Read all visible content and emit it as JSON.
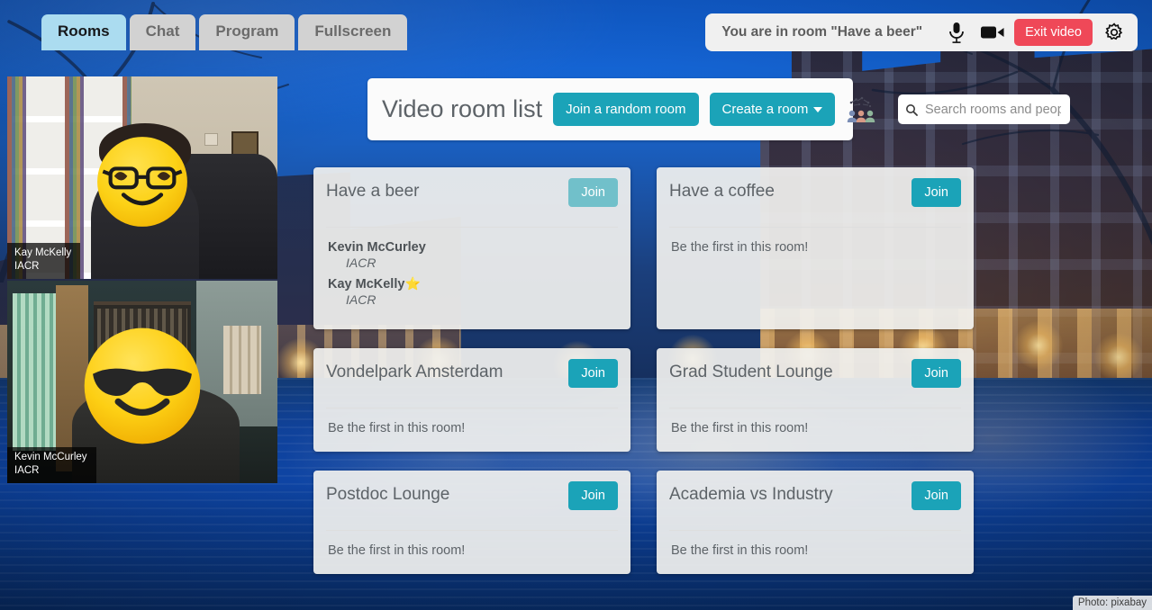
{
  "nav": {
    "tabs": [
      {
        "label": "Rooms",
        "active": true
      },
      {
        "label": "Chat",
        "active": false
      },
      {
        "label": "Program",
        "active": false
      },
      {
        "label": "Fullscreen",
        "active": false
      }
    ]
  },
  "topbar": {
    "room_status": "You are in room \"Have a beer\"",
    "mic_icon": "microphone-icon",
    "camera_icon": "video-camera-icon",
    "exit_label": "Exit video",
    "settings_icon": "gear-icon",
    "exit_color": "#ef4858"
  },
  "video_tiles": [
    {
      "name": "Kay McKelly",
      "affiliation": "IACR",
      "avatar_emoji": "nerd-face",
      "scene": "bookshelf-office"
    },
    {
      "name": "Kevin McCurley",
      "affiliation": "IACR",
      "avatar_emoji": "smiling-face-with-sunglasses",
      "scene": "dark-room-window"
    }
  ],
  "header": {
    "title": "Video room list",
    "random_room_label": "Join a random room",
    "create_room_label": "Create a room",
    "people_icon": "people-network-icon",
    "accent_color": "#1ba3b8"
  },
  "search": {
    "placeholder": "Search rooms and people",
    "value": "",
    "icon": "search-icon"
  },
  "rooms": [
    {
      "name": "Have a beer",
      "join_label": "Join",
      "join_disabled": true,
      "empty_message": "",
      "occupants": [
        {
          "name": "Kevin McCurley",
          "affiliation": "IACR",
          "starred": false
        },
        {
          "name": "Kay McKelly",
          "affiliation": "IACR",
          "starred": true
        }
      ]
    },
    {
      "name": "Have a coffee",
      "join_label": "Join",
      "join_disabled": false,
      "empty_message": "Be the first in this room!",
      "occupants": []
    },
    {
      "name": "Vondelpark Amsterdam",
      "join_label": "Join",
      "join_disabled": false,
      "empty_message": "Be the first in this room!",
      "occupants": []
    },
    {
      "name": "Grad Student Lounge",
      "join_label": "Join",
      "join_disabled": false,
      "empty_message": "Be the first in this room!",
      "occupants": []
    },
    {
      "name": "Postdoc Lounge",
      "join_label": "Join",
      "join_disabled": false,
      "empty_message": "Be the first in this room!",
      "occupants": []
    },
    {
      "name": "Academia vs Industry",
      "join_label": "Join",
      "join_disabled": false,
      "empty_message": "Be the first in this room!",
      "occupants": []
    }
  ],
  "credit": {
    "text": "Photo: pixabay"
  },
  "star_glyph": "⭐"
}
